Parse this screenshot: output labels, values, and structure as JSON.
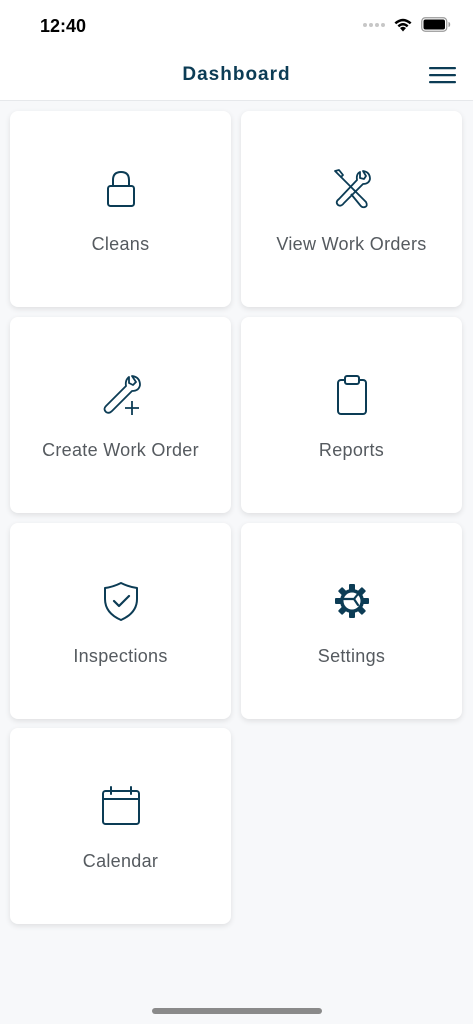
{
  "status_bar": {
    "time": "12:40"
  },
  "header": {
    "title": "Dashboard",
    "menu_icon": "hamburger-menu-icon"
  },
  "tiles": [
    {
      "label": "Cleans",
      "icon": "lock-icon"
    },
    {
      "label": "View Work Orders",
      "icon": "tools-icon"
    },
    {
      "label": "Create Work Order",
      "icon": "wrench-plus-icon"
    },
    {
      "label": "Reports",
      "icon": "clipboard-icon"
    },
    {
      "label": "Inspections",
      "icon": "shield-check-icon"
    },
    {
      "label": "Settings",
      "icon": "gear-icon"
    },
    {
      "label": "Calendar",
      "icon": "calendar-icon"
    }
  ],
  "colors": {
    "primary": "#0c3c55",
    "label": "#555a5f",
    "background": "#f7f8fa"
  }
}
